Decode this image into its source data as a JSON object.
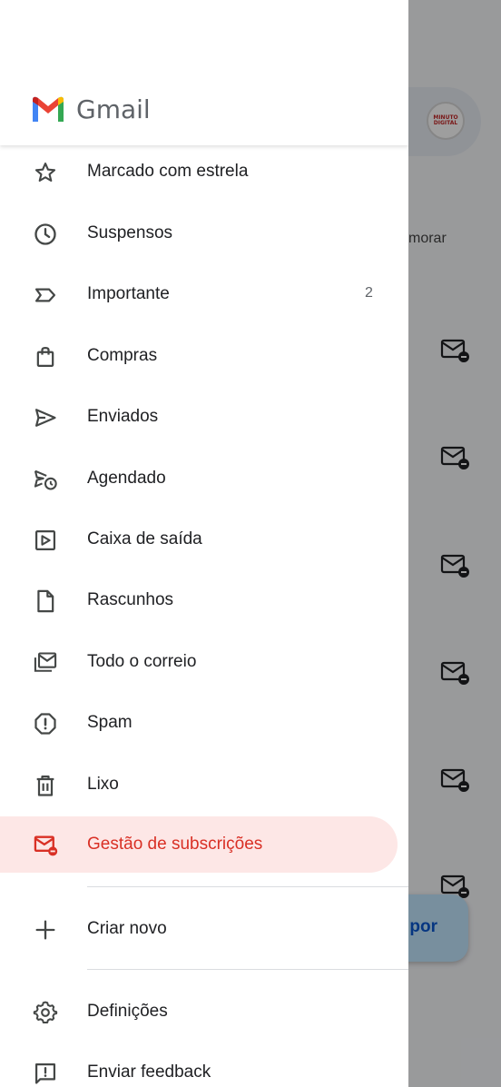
{
  "app": {
    "name": "Gmail"
  },
  "background": {
    "snooze_label_fragment": "morar",
    "compose_fab_fragment": "por",
    "avatar_logo_text": "MINUTO DIGITAL"
  },
  "drawer": {
    "items": [
      {
        "label": "Marcado com estrela",
        "icon": "star-icon"
      },
      {
        "label": "Suspensos",
        "icon": "clock-icon"
      },
      {
        "label": "Importante",
        "icon": "label-important-icon",
        "count": "2"
      },
      {
        "label": "Compras",
        "icon": "shopping-bag-icon"
      },
      {
        "label": "Enviados",
        "icon": "send-icon"
      },
      {
        "label": "Agendado",
        "icon": "schedule-send-icon"
      },
      {
        "label": "Caixa de saída",
        "icon": "outbox-icon"
      },
      {
        "label": "Rascunhos",
        "icon": "draft-icon"
      },
      {
        "label": "Todo o correio",
        "icon": "all-mail-icon"
      },
      {
        "label": "Spam",
        "icon": "spam-icon"
      },
      {
        "label": "Lixo",
        "icon": "trash-icon"
      },
      {
        "label": "Gestão de subscrições",
        "icon": "subscriptions-icon",
        "active": true
      }
    ],
    "create_new": {
      "label": "Criar novo",
      "icon": "plus-icon"
    },
    "settings": {
      "label": "Definições",
      "icon": "gear-icon"
    },
    "feedback": {
      "label": "Enviar feedback",
      "icon": "feedback-icon"
    }
  },
  "colors": {
    "active_text": "#d93025",
    "active_bg": "#fde7e6",
    "gmail_red": "#ea4335",
    "gmail_blue": "#4285f4",
    "gmail_green": "#34a853",
    "gmail_yellow": "#fbbc04"
  }
}
